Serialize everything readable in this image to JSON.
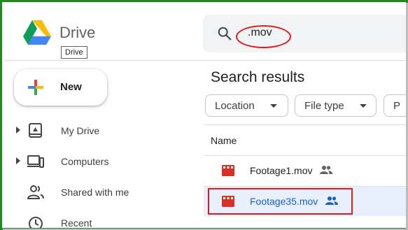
{
  "app": {
    "title": "Drive",
    "tooltip": "Drive"
  },
  "search": {
    "value": ".mov"
  },
  "sidebar": {
    "new_label": "New",
    "items": [
      {
        "label": "My Drive",
        "icon": "my-drive-icon"
      },
      {
        "label": "Computers",
        "icon": "computers-icon"
      },
      {
        "label": "Shared with me",
        "icon": "shared-with-me-icon"
      },
      {
        "label": "Recent",
        "icon": "recent-icon"
      }
    ]
  },
  "main": {
    "heading": "Search results",
    "filters": [
      {
        "label": "Location"
      },
      {
        "label": "File type"
      },
      {
        "label": "P"
      }
    ],
    "column_header": "Name",
    "files": [
      {
        "name": "Footage1.mov",
        "shared": true,
        "selected": false
      },
      {
        "name": "Footage35.mov",
        "shared": true,
        "selected": true
      }
    ]
  },
  "colors": {
    "frame_border": "#1f8a1f",
    "annotation_red": "#e01b1b",
    "selected_row": "#e8f0fe",
    "selected_text": "#1a5fc4",
    "video_icon": "#d93025"
  }
}
